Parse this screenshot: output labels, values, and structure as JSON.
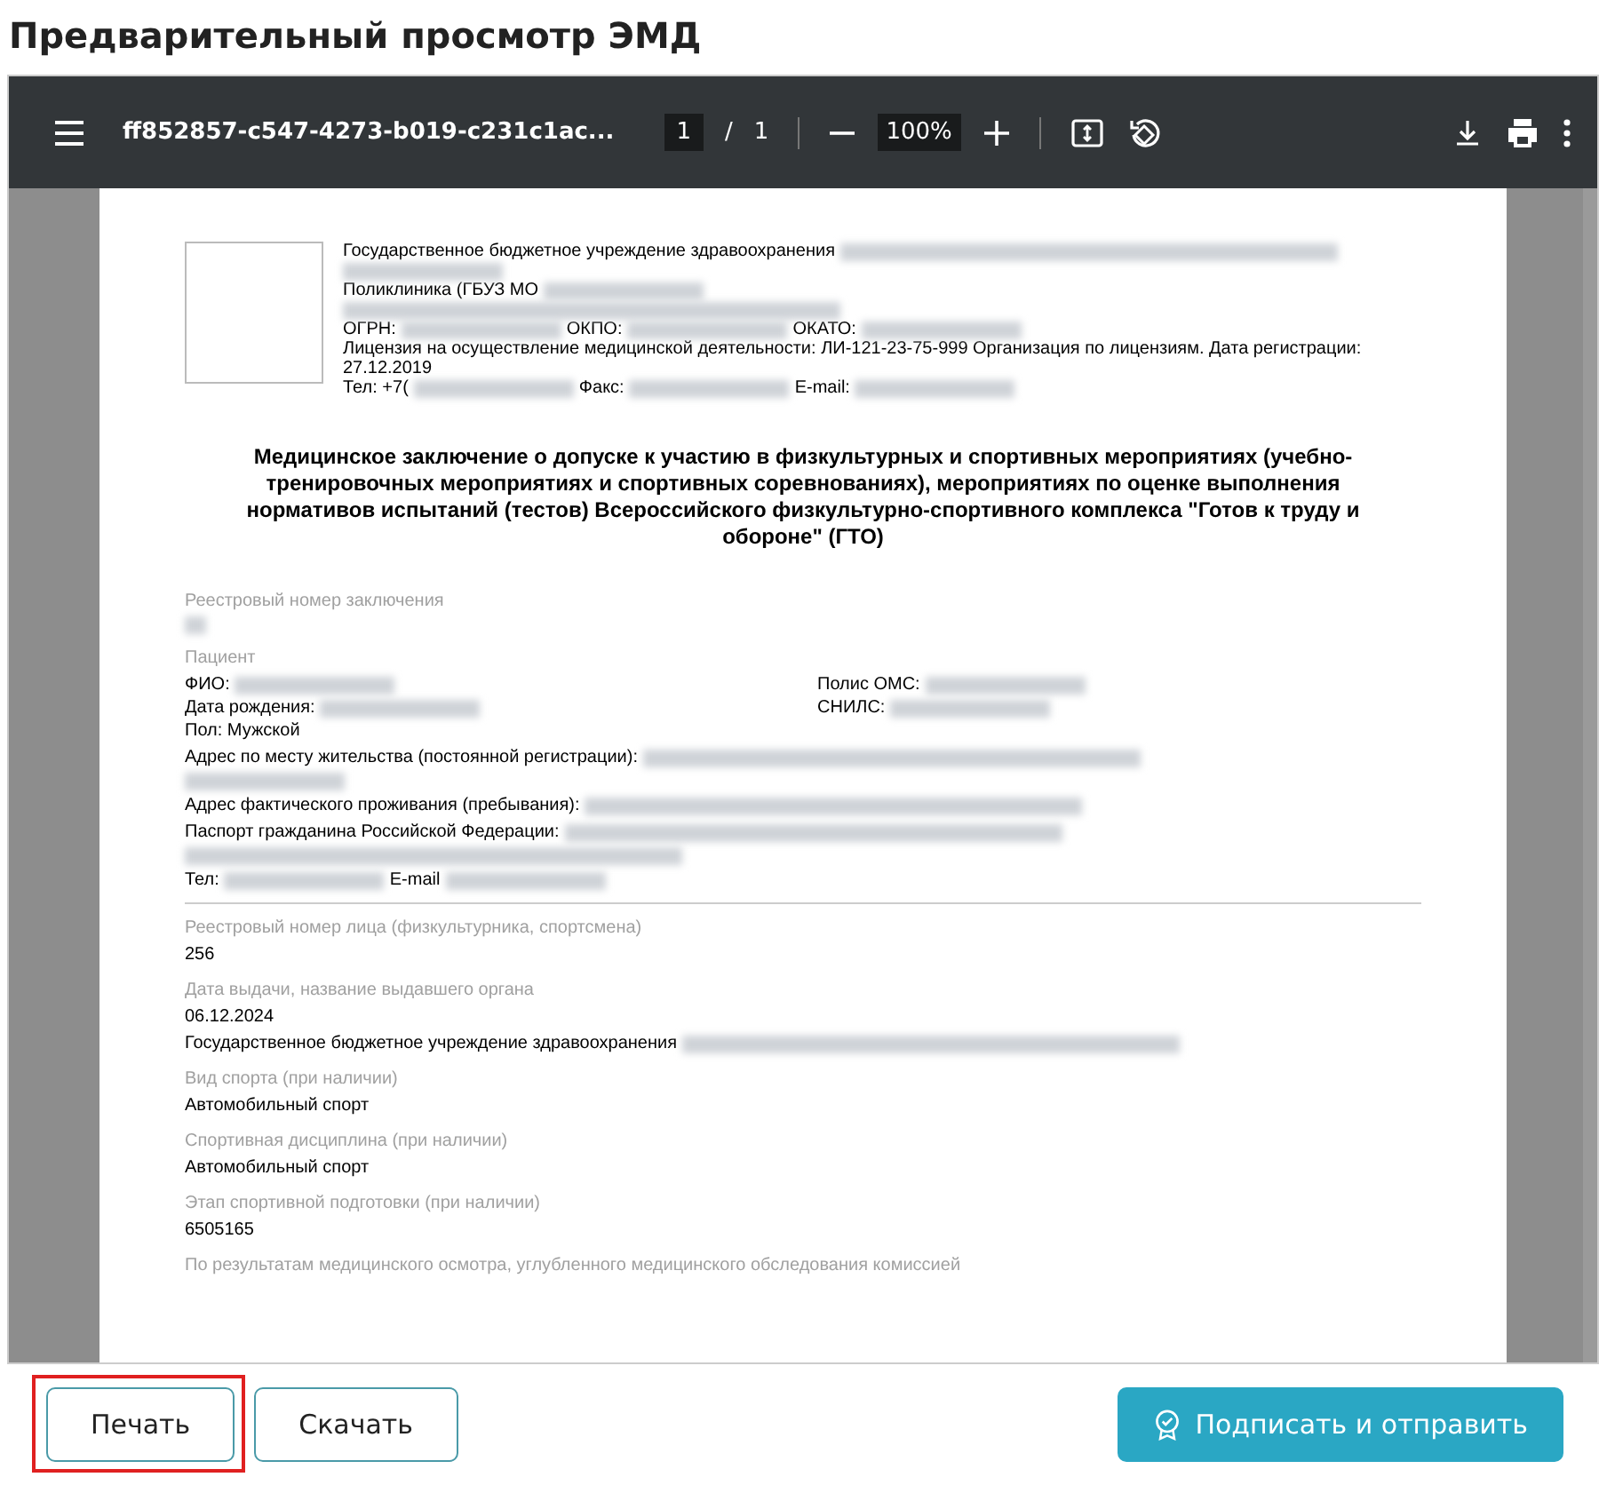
{
  "title": "Предварительный просмотр ЭМД",
  "viewer": {
    "file_name": "ff852857-c547-4273-b019-c231c1ac...",
    "page_current": "1",
    "page_separator": "/",
    "page_total": "1",
    "zoom": "100%"
  },
  "document": {
    "org": [
      [
        {
          "kind": "text",
          "text": "Государственное бюджетное учреждение здравоохранения"
        },
        {
          "kind": "longblur"
        }
      ],
      [
        {
          "kind": "blur"
        }
      ],
      [
        {
          "kind": "text",
          "text": "Поликлиника (ГБУЗ МО"
        },
        {
          "kind": "blur"
        }
      ],
      [
        {
          "kind": "longblur"
        }
      ],
      [
        {
          "kind": "text",
          "text": "ОГРН:"
        },
        {
          "kind": "blur"
        },
        {
          "kind": "text",
          "text": "ОКПО:"
        },
        {
          "kind": "blur"
        },
        {
          "kind": "text",
          "text": "ОКАТО:"
        },
        {
          "kind": "blur"
        }
      ],
      [
        {
          "kind": "text",
          "text": "Лицензия на осуществление медицинской деятельности: ЛИ-121-23-75-999 Организация по лицензиям. Дата регистрации: 27.12.2019"
        }
      ],
      [
        {
          "kind": "text",
          "text": "Тел: +7("
        },
        {
          "kind": "blur"
        },
        {
          "kind": "text",
          "text": "Факс:"
        },
        {
          "kind": "blur"
        },
        {
          "kind": "text",
          "text": "E-mail:"
        },
        {
          "kind": "blur"
        }
      ]
    ],
    "heading": "Медицинское заключение о допуске к участию в физкультурных и спортивных мероприятиях (учебно-тренировочных мероприятиях и спортивных соревнованиях), мероприятиях по оценке выполнения нормативов испытаний (тестов) Всероссийского физкультурно-спортивного комплекса \"Готов к труду и обороне\" (ГТО)",
    "blocks": [
      {
        "kind": "caption",
        "text": "Реестровый номер заключения"
      },
      {
        "kind": "line",
        "segments": [
          {
            "kind": "speck"
          }
        ]
      },
      {
        "kind": "caption",
        "text": "Пациент"
      },
      {
        "kind": "pairs",
        "rows": [
          [
            [
              {
                "kind": "text",
                "text": "ФИО:"
              },
              {
                "kind": "blur"
              }
            ],
            [
              {
                "kind": "text",
                "text": "Полис ОМС:"
              },
              {
                "kind": "blur"
              }
            ]
          ],
          [
            [
              {
                "kind": "text",
                "text": "Дата рождения:"
              },
              {
                "kind": "blur"
              }
            ],
            [
              {
                "kind": "text",
                "text": "СНИЛС:"
              },
              {
                "kind": "blur"
              }
            ]
          ],
          [
            [
              {
                "kind": "text",
                "text": "Пол: Мужской"
              }
            ],
            []
          ]
        ]
      },
      {
        "kind": "line",
        "segments": [
          {
            "kind": "text",
            "text": "Адрес по месту жительства (постоянной регистрации):"
          },
          {
            "kind": "longblur"
          }
        ]
      },
      {
        "kind": "line",
        "segments": [
          {
            "kind": "blur"
          }
        ]
      },
      {
        "kind": "line",
        "segments": [
          {
            "kind": "text",
            "text": "Адрес фактического проживания (пребывания):"
          },
          {
            "kind": "longblur"
          }
        ]
      },
      {
        "kind": "line",
        "segments": [
          {
            "kind": "text",
            "text": "Паспорт гражданина Российской Федерации:"
          },
          {
            "kind": "longblur"
          }
        ]
      },
      {
        "kind": "line",
        "segments": [
          {
            "kind": "longblur"
          }
        ]
      },
      {
        "kind": "line",
        "segments": [
          {
            "kind": "text",
            "text": "Тел:"
          },
          {
            "kind": "blur"
          },
          {
            "kind": "text",
            "text": "E-mail"
          },
          {
            "kind": "blur"
          }
        ]
      },
      {
        "kind": "rule"
      },
      {
        "kind": "caption",
        "text": "Реестровый номер лица (физкультурника, спортсмена)"
      },
      {
        "kind": "line",
        "segments": [
          {
            "kind": "text",
            "text": "256"
          }
        ]
      },
      {
        "kind": "caption",
        "text": "Дата выдачи, название выдавшего органа"
      },
      {
        "kind": "line",
        "segments": [
          {
            "kind": "text",
            "text": "06.12.2024"
          }
        ]
      },
      {
        "kind": "line",
        "segments": [
          {
            "kind": "text",
            "text": "Государственное бюджетное учреждение здравоохранения"
          },
          {
            "kind": "longblur"
          }
        ]
      },
      {
        "kind": "caption",
        "text": "Вид спорта (при наличии)"
      },
      {
        "kind": "line",
        "segments": [
          {
            "kind": "text",
            "text": "Автомобильный спорт"
          }
        ]
      },
      {
        "kind": "caption",
        "text": "Спортивная дисциплина (при наличии)"
      },
      {
        "kind": "line",
        "segments": [
          {
            "kind": "text",
            "text": "Автомобильный спорт"
          }
        ]
      },
      {
        "kind": "caption",
        "text": "Этап спортивной подготовки (при наличии)"
      },
      {
        "kind": "line",
        "segments": [
          {
            "kind": "text",
            "text": "6505165"
          }
        ]
      },
      {
        "kind": "caption",
        "text": "По результатам медицинского осмотра, углубленного медицинского обследования комиссией"
      }
    ]
  },
  "buttons": [
    {
      "label": "Печать",
      "kind": "outline",
      "highlighted": true
    },
    {
      "label": "Скачать",
      "kind": "outline",
      "highlighted": false
    },
    {
      "label": "Подписать и отправить",
      "kind": "primary",
      "highlighted": false
    }
  ]
}
